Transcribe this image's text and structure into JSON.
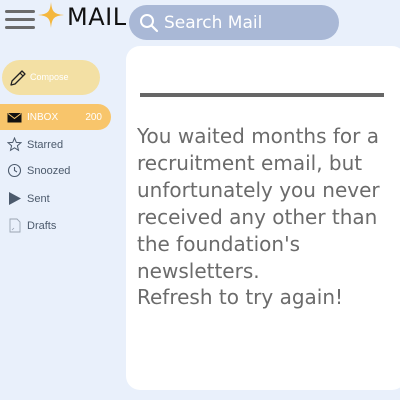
{
  "header": {
    "title": "MAIL",
    "search_placeholder": "Search Mail"
  },
  "sidebar": {
    "compose_label": "Compose",
    "items": [
      {
        "label": "INBOX",
        "count": "200",
        "icon": "envelope-icon",
        "active": true
      },
      {
        "label": "Starred",
        "icon": "star-icon"
      },
      {
        "label": "Snoozed",
        "icon": "clock-icon"
      },
      {
        "label": "Sent",
        "icon": "play-icon"
      },
      {
        "label": "Drafts",
        "icon": "document-icon"
      }
    ]
  },
  "main": {
    "message": "You waited months for a recruitment email, but unfortunately you never received any other than the foundation's newsletters.",
    "refresh": "Refresh to try again!"
  },
  "colors": {
    "background": "#e9f0fb",
    "search": "#a9b8d6",
    "compose": "#f3e0a4",
    "active": "#f8c56b",
    "logo_star": "#f4b73e"
  }
}
